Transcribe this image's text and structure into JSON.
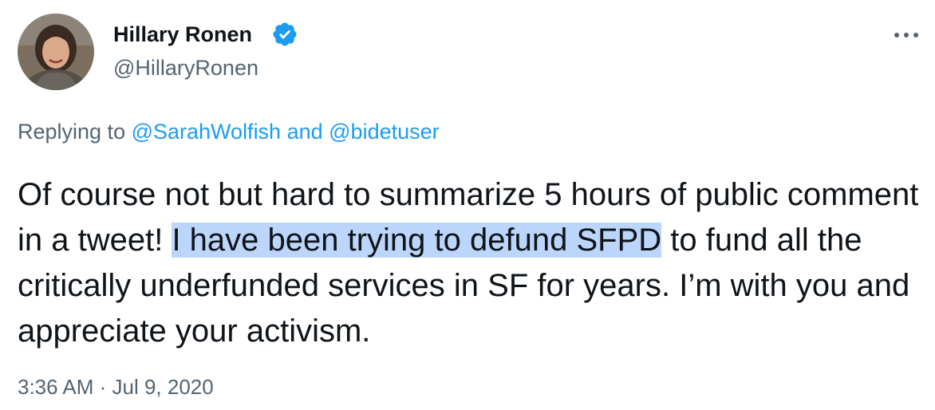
{
  "author": {
    "display_name": "Hillary Ronen",
    "handle": "@HillaryRonen",
    "verified_icon": "verified-badge-icon",
    "avatar": "profile-photo"
  },
  "reply": {
    "prefix": "Replying to ",
    "mention_1": "@SarahWolfish",
    "connector": " and ",
    "mention_2": "@bidetuser"
  },
  "tweet": {
    "text_before_highlight": "Of course not but hard to summarize 5 hours of public comment in a tweet! ",
    "highlighted_text": "I have been trying to defund SFPD",
    "text_after_highlight": " to fund all the critically underfunded services in SF for years. I’m with you and appreciate your activism.",
    "time": "3:36 AM",
    "separator": " · ",
    "date": "Jul 9, 2020"
  },
  "menu": {
    "more_icon": "more-options-icon"
  },
  "colors": {
    "link": "#1d9bf0",
    "secondary_text": "#536471",
    "primary_text": "#0f1419",
    "highlight": "#bcd6fb",
    "verified": "#1d9bf0"
  }
}
